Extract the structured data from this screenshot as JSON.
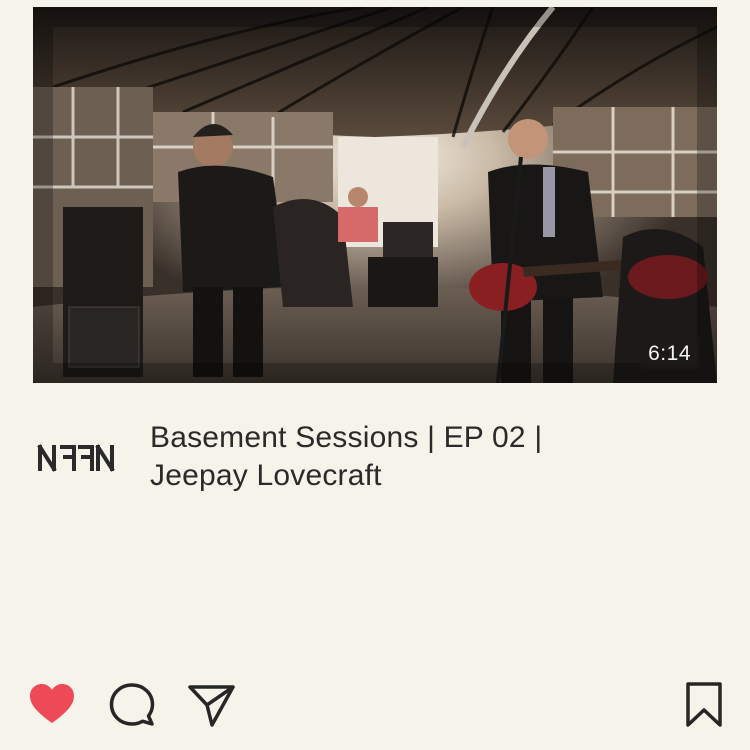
{
  "video": {
    "duration": "6:14",
    "thumbnail": "basement-band-performance-photo"
  },
  "channel": {
    "logo_icon": "nffn-logo-icon"
  },
  "post": {
    "title_line1": "Basement Sessions | EP 02 |",
    "title_line2": "Jeepay Lovecraft"
  },
  "actions": {
    "like_icon": "heart-icon",
    "comment_icon": "comment-bubble-icon",
    "share_icon": "send-paper-plane-icon",
    "save_icon": "bookmark-icon"
  },
  "colors": {
    "background": "#f6f4ea",
    "like": "#ed4956",
    "icon_stroke": "#262626",
    "text": "#2a2a2a"
  }
}
